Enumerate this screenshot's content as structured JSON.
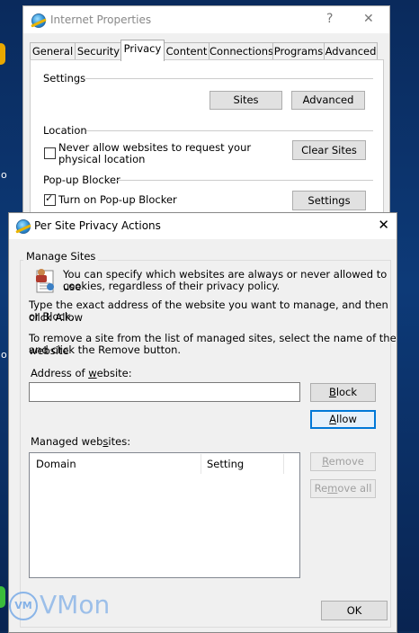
{
  "internet_properties": {
    "title": "Internet Properties",
    "help_glyph": "?",
    "close_glyph": "✕",
    "tabs": [
      {
        "label": "General"
      },
      {
        "label": "Security"
      },
      {
        "label": "Privacy"
      },
      {
        "label": "Content"
      },
      {
        "label": "Connections"
      },
      {
        "label": "Programs"
      },
      {
        "label": "Advanced"
      }
    ],
    "active_tab": "Privacy",
    "settings_group": "Settings",
    "sites_button": "Sites",
    "advanced_button": "Advanced",
    "location_group": "Location",
    "location_checkbox_line1": "Never allow websites to request your",
    "location_checkbox_line2": "physical location",
    "location_checked": false,
    "clear_sites_button": "Clear Sites",
    "popup_group": "Pop-up Blocker",
    "popup_checkbox": "Turn on Pop-up Blocker",
    "popup_checked": true,
    "popup_settings_button": "Settings"
  },
  "per_site": {
    "title": "Per Site Privacy Actions",
    "close_glyph": "✕",
    "group_label": "Manage Sites",
    "intro_line1": "You can specify which websites are always or never allowed to use",
    "intro_line2": "cookies, regardless of their privacy policy.",
    "instr1_line1": "Type the exact address of the website you want to manage, and then click Allow",
    "instr1_line2": "or Block.",
    "instr2_line1": "To remove a site from the list of managed sites, select the name of the website",
    "instr2_line2": "and click the Remove button.",
    "address_label_pre": "Address of ",
    "address_label_ul": "w",
    "address_label_post": "ebsite:",
    "address_value": "",
    "block_button_ul": "B",
    "block_button_rest": "lock",
    "allow_button_ul": "A",
    "allow_button_rest": "llow",
    "managed_label_pre": "Managed web",
    "managed_label_ul": "s",
    "managed_label_post": "ites:",
    "columns": [
      "Domain",
      "Setting"
    ],
    "remove_button_ul": "R",
    "remove_button_rest": "emove",
    "remove_all_pre": "Re",
    "remove_all_ul": "m",
    "remove_all_post": "ove all",
    "ok_button": "OK"
  },
  "desktop": {
    "left_text_1": "o",
    "left_text_2": "o"
  },
  "watermark": {
    "badge": "VM",
    "text": "VMon"
  },
  "colors": {
    "accent": "#0078d7",
    "desktop_bg": "#0b2a57",
    "window_bg": "#f0f0f0"
  }
}
